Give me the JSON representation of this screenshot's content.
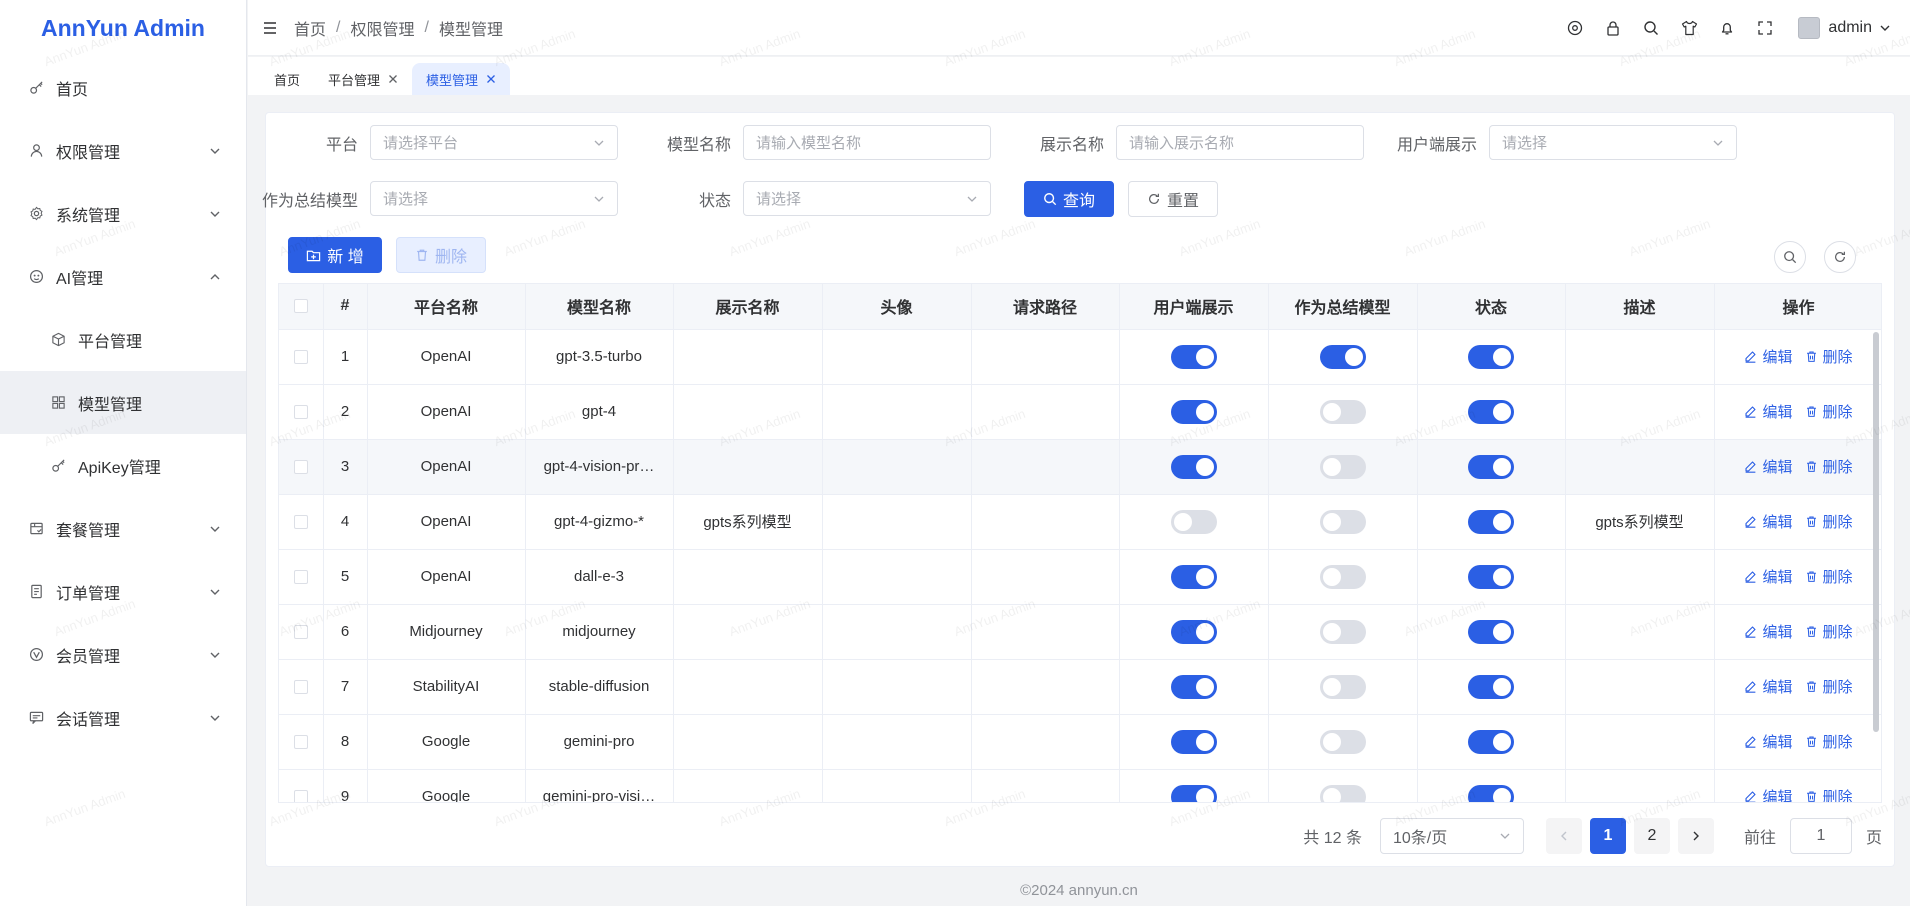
{
  "app": {
    "title": "AnnYun Admin",
    "watermark": "AnnYun Admin",
    "footer": "©2024 annyun.cn"
  },
  "sidebar": {
    "items": [
      {
        "label": "首页",
        "icon": "key-icon",
        "chevron": ""
      },
      {
        "label": "权限管理",
        "icon": "user-icon",
        "chevron": "down"
      },
      {
        "label": "系统管理",
        "icon": "settings-icon",
        "chevron": "down"
      },
      {
        "label": "AI管理",
        "icon": "ai-icon",
        "chevron": "up"
      },
      {
        "label": "平台管理",
        "icon": "box-icon",
        "sub": true
      },
      {
        "label": "模型管理",
        "icon": "grid-icon",
        "sub": true,
        "active": true
      },
      {
        "label": "ApiKey管理",
        "icon": "key-icon",
        "sub": true
      },
      {
        "label": "套餐管理",
        "icon": "package-icon",
        "chevron": "down"
      },
      {
        "label": "订单管理",
        "icon": "order-icon",
        "chevron": "down"
      },
      {
        "label": "会员管理",
        "icon": "vip-icon",
        "chevron": "down"
      },
      {
        "label": "会话管理",
        "icon": "chat-icon",
        "chevron": "down"
      }
    ]
  },
  "header": {
    "breadcrumb": [
      "首页",
      "权限管理",
      "模型管理"
    ],
    "user": "admin"
  },
  "tabs": [
    {
      "label": "首页",
      "closable": false
    },
    {
      "label": "平台管理",
      "closable": true
    },
    {
      "label": "模型管理",
      "closable": true,
      "active": true
    }
  ],
  "filters": {
    "platform": {
      "label": "平台",
      "placeholder": "请选择平台"
    },
    "model_name": {
      "label": "模型名称",
      "placeholder": "请输入模型名称"
    },
    "display_name": {
      "label": "展示名称",
      "placeholder": "请输入展示名称"
    },
    "client_display": {
      "label": "用户端展示",
      "placeholder": "请选择"
    },
    "summary_model": {
      "label": "作为总结模型",
      "placeholder": "请选择"
    },
    "status": {
      "label": "状态",
      "placeholder": "请选择"
    },
    "query_label": "查询",
    "reset_label": "重置"
  },
  "toolbar": {
    "add_label": "新 增",
    "delete_label": "删除"
  },
  "table": {
    "columns": [
      "#",
      "平台名称",
      "模型名称",
      "展示名称",
      "头像",
      "请求路径",
      "用户端展示",
      "作为总结模型",
      "状态",
      "描述",
      "操作"
    ],
    "edit_label": "编辑",
    "delete_label": "删除",
    "rows": [
      {
        "no": "1",
        "platform": "OpenAI",
        "model": "gpt-3.5-turbo",
        "display": "",
        "client": true,
        "summary": true,
        "status": true,
        "desc": ""
      },
      {
        "no": "2",
        "platform": "OpenAI",
        "model": "gpt-4",
        "display": "",
        "client": true,
        "summary": false,
        "status": true,
        "desc": ""
      },
      {
        "no": "3",
        "platform": "OpenAI",
        "model": "gpt-4-vision-pr…",
        "display": "",
        "client": true,
        "summary": false,
        "status": true,
        "desc": ""
      },
      {
        "no": "4",
        "platform": "OpenAI",
        "model": "gpt-4-gizmo-*",
        "display": "gpts系列模型",
        "client": false,
        "summary": false,
        "status": true,
        "desc": "gpts系列模型"
      },
      {
        "no": "5",
        "platform": "OpenAI",
        "model": "dall-e-3",
        "display": "",
        "client": true,
        "summary": false,
        "status": true,
        "desc": ""
      },
      {
        "no": "6",
        "platform": "Midjourney",
        "model": "midjourney",
        "display": "",
        "client": true,
        "summary": false,
        "status": true,
        "desc": ""
      },
      {
        "no": "7",
        "platform": "StabilityAI",
        "model": "stable-diffusion",
        "display": "",
        "client": true,
        "summary": false,
        "status": true,
        "desc": ""
      },
      {
        "no": "8",
        "platform": "Google",
        "model": "gemini-pro",
        "display": "",
        "client": true,
        "summary": false,
        "status": true,
        "desc": ""
      },
      {
        "no": "9",
        "platform": "Google",
        "model": "gemini-pro-visi…",
        "display": "",
        "client": true,
        "summary": false,
        "status": true,
        "desc": ""
      }
    ]
  },
  "pagination": {
    "total": "共 12 条",
    "page_size": "10条/页",
    "pages": [
      "1",
      "2"
    ],
    "current": "1",
    "goto_label": "前往",
    "goto_value": "1",
    "page_suffix": "页"
  },
  "colors": {
    "primary": "#2b5fe4",
    "switch_off": "#dcdfe6"
  }
}
